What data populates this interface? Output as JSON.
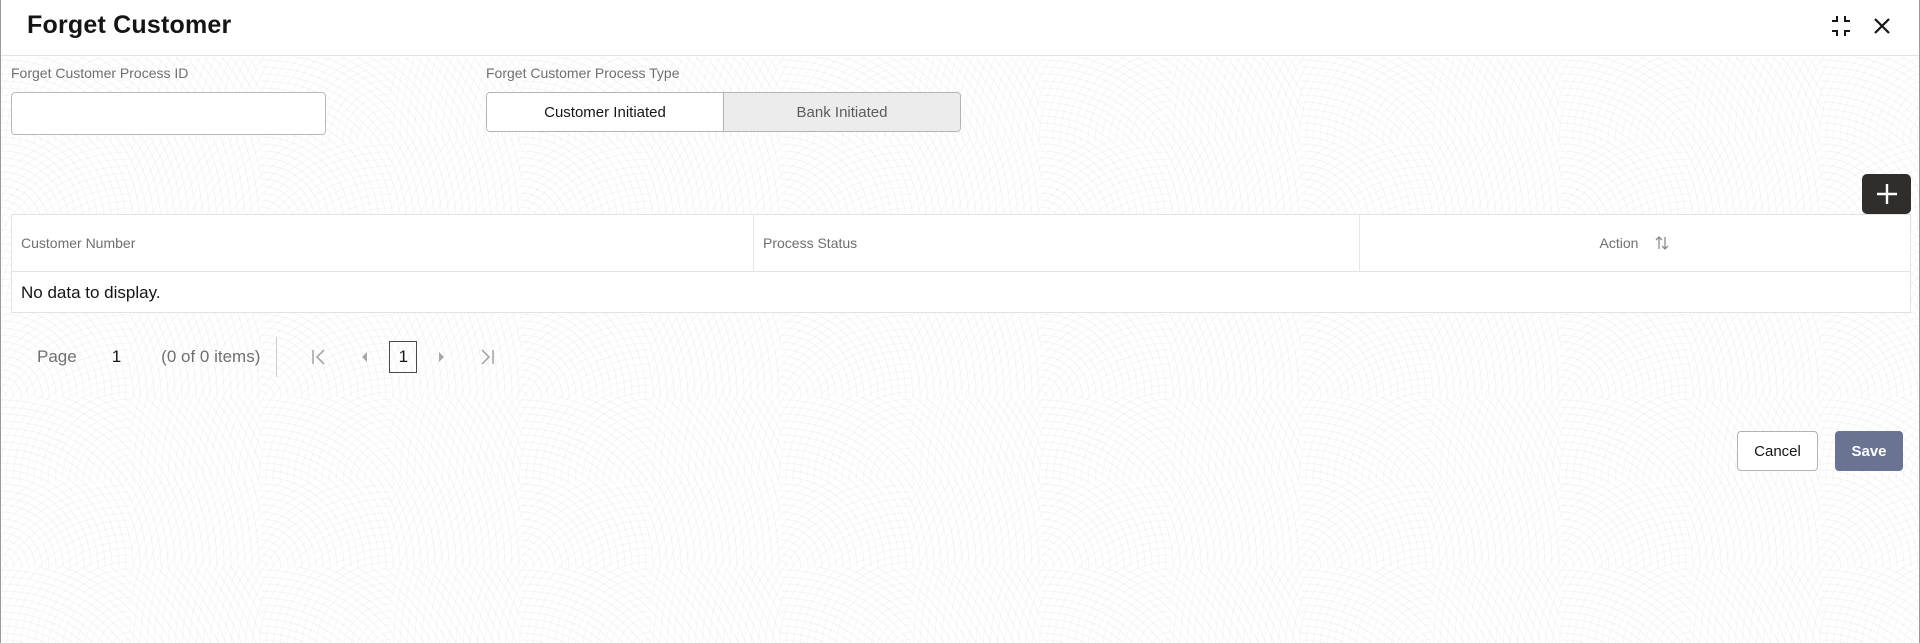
{
  "dialog": {
    "title": "Forget Customer",
    "header_icons": [
      "collapse-icon",
      "close-icon"
    ]
  },
  "form": {
    "process_id": {
      "label": "Forget Customer Process ID",
      "value": "",
      "placeholder": ""
    },
    "process_type": {
      "label": "Forget Customer Process Type",
      "options": [
        {
          "label": "Customer Initiated",
          "selected": true
        },
        {
          "label": "Bank Initiated",
          "selected": false
        }
      ]
    }
  },
  "table": {
    "add_button_icon": "plus-icon",
    "columns": [
      {
        "label": "Customer Number"
      },
      {
        "label": "Process Status"
      },
      {
        "label": "Action",
        "sort_icon": "sort-icon"
      }
    ],
    "rows": [],
    "empty_message": "No data to display."
  },
  "pagination": {
    "page_label": "Page",
    "page_value": "1",
    "items_summary": "(0 of 0 items)",
    "current_page": "1",
    "icons": [
      "first-page-icon",
      "previous-page-icon",
      "next-page-icon",
      "last-page-icon"
    ]
  },
  "footer": {
    "cancel_label": "Cancel",
    "save_label": "Save",
    "save_color": "#6b7393"
  }
}
